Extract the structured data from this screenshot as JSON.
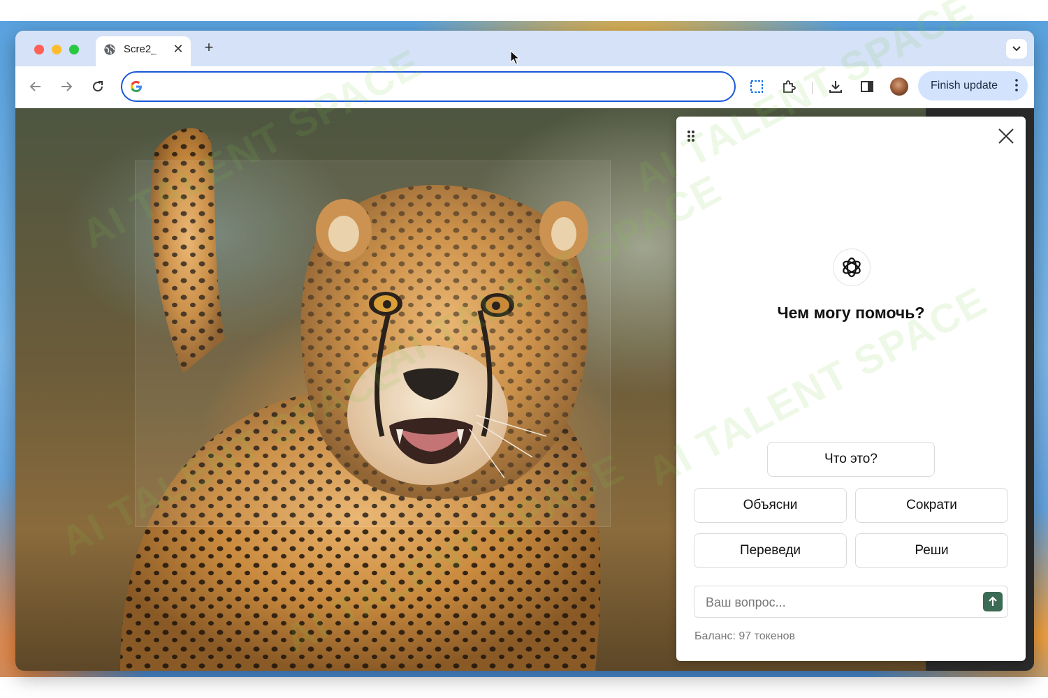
{
  "tab": {
    "title": "Scre2_",
    "favicon": "globe-icon",
    "close_symbol": "✕"
  },
  "tabstrip": {
    "new_tab_symbol": "+",
    "tab_search_symbol": "⌄"
  },
  "toolbar": {
    "back": "arrow-left-icon",
    "forward": "arrow-right-icon",
    "reload": "reload-icon",
    "omnibox_value": "",
    "capture": "capture-region-icon",
    "extensions": "puzzle-icon",
    "downloads": "download-icon",
    "side_panel": "side-panel-icon",
    "profile": "avatar",
    "finish_update_label": "Finish update"
  },
  "assistant": {
    "heading": "Чем могу помочь?",
    "buttons": {
      "what": "Что это?",
      "explain": "Объясни",
      "shorten": "Сократи",
      "translate": "Переведи",
      "solve": "Реши"
    },
    "question_placeholder": "Ваш вопрос...",
    "balance": "Баланс: 97 токенов"
  },
  "watermark": {
    "text": "AI TALENT SPACE"
  },
  "colors": {
    "tabstrip": "#d5e2f7",
    "omnibox_border": "#1a57d6",
    "finish_update_bg": "#d3e3fd",
    "send_button": "#3b6a55",
    "capture_icon": "#1a73e8"
  }
}
